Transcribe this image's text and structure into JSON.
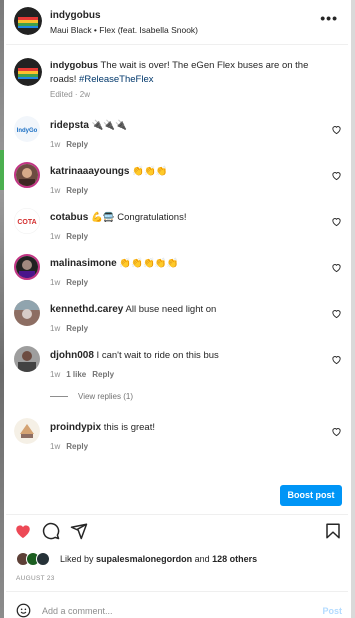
{
  "post": {
    "author": "indygobus",
    "audio": "Maui Black • Flex (feat. Isabella Snook)",
    "more_icon": "more-horizontal-icon"
  },
  "caption": {
    "author": "indygobus",
    "text": "The wait is over! The eGen Flex buses are on the roads!",
    "hashtag": "#ReleaseTheFlex",
    "meta": "Edited · 2w"
  },
  "comments": [
    {
      "user": "ridepsta",
      "text": "🔌🔌🔌",
      "time": "1w",
      "likes": "",
      "reply": "Reply"
    },
    {
      "user": "katrinaaayoungs",
      "text": "👏👏👏",
      "time": "1w",
      "likes": "",
      "reply": "Reply"
    },
    {
      "user": "cotabus",
      "text": "💪🚍 Congratulations!",
      "time": "1w",
      "likes": "",
      "reply": "Reply"
    },
    {
      "user": "malinasimone",
      "text": "👏👏👏👏👏",
      "time": "1w",
      "likes": "",
      "reply": "Reply"
    },
    {
      "user": "kennethd.carey",
      "text": "All buse need light on",
      "time": "1w",
      "likes": "",
      "reply": "Reply"
    },
    {
      "user": "djohn008",
      "text": "I can't wait to ride on this bus",
      "time": "1w",
      "likes": "1 like",
      "reply": "Reply"
    },
    {
      "user": "proindypix",
      "text": "this is great!",
      "time": "1w",
      "likes": "",
      "reply": "Reply"
    }
  ],
  "view_replies": "View replies (1)",
  "boost_label": "Boost post",
  "likes": {
    "prefix": "Liked by",
    "user": "supalesmalonegordon",
    "middle": "and",
    "others": "128 others"
  },
  "date": "AUGUST 23",
  "add_comment": {
    "placeholder": "Add a comment...",
    "post_label": "Post"
  },
  "colors": {
    "accent": "#0095f6",
    "like_red": "#ed4956",
    "link": "#00376b"
  }
}
